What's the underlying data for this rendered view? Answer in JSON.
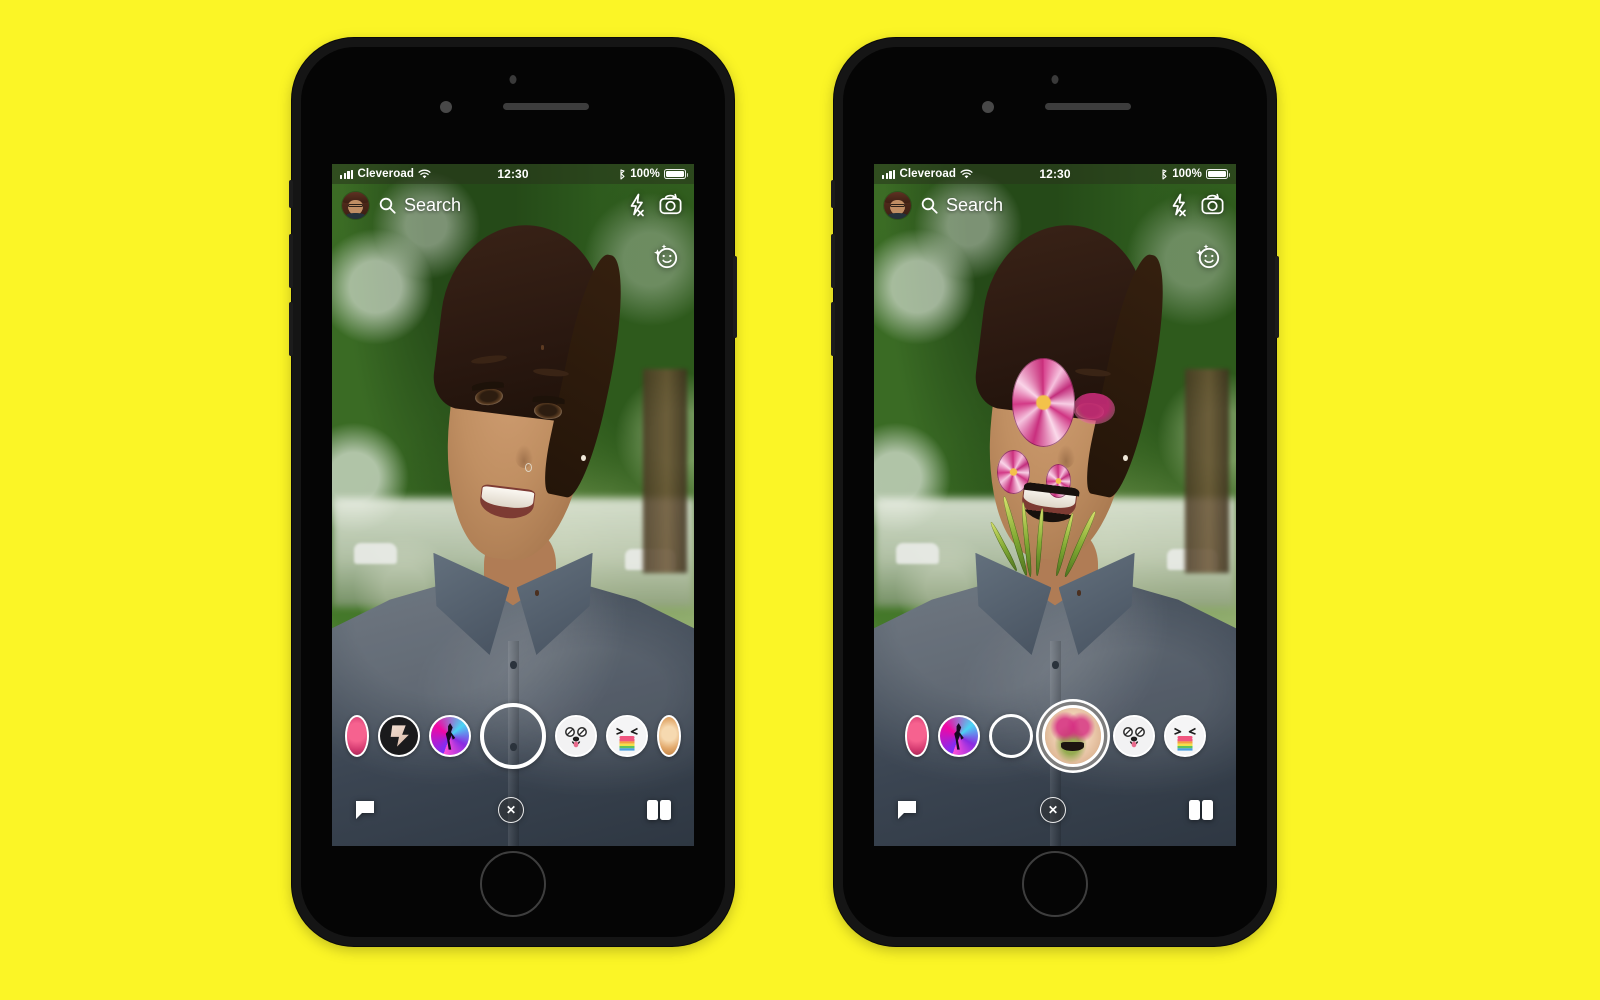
{
  "background": {
    "color": "#FBF526"
  },
  "status_bar": {
    "carrier": "Cleveroad",
    "time": "12:30",
    "battery_percent": "100%",
    "signal_icon": "cellular-bars-icon",
    "wifi_icon": "wifi-icon",
    "bluetooth_icon": "bluetooth-icon",
    "battery_icon": "battery-full-icon"
  },
  "top_bar": {
    "avatar_name": "bitmoji-avatar",
    "search_placeholder": "Search",
    "search_icon": "search-icon",
    "flash_icon": "flash-off-icon",
    "camera_flip_icon": "camera-flip-icon",
    "lens_toggle_icon": "lens-smiley-icon"
  },
  "bottom_nav": {
    "chat_icon": "chat-bubble-icon",
    "close_icon": "close-x-icon",
    "close_label": "✕",
    "stories_icon": "stories-cards-icon"
  },
  "phones": [
    {
      "id": "phone-left",
      "state_label": "camera-no-lens-applied",
      "carousel": {
        "shutter_name": "shutter-button",
        "shutter_selected": false,
        "lenses": [
          {
            "name": "lens-pink-edge",
            "art": "th-pink",
            "edge": true,
            "selected": false
          },
          {
            "name": "lens-dark-figure",
            "art": "th-dark",
            "edge": false,
            "selected": false
          },
          {
            "name": "lens-disco",
            "art": "th-disco",
            "edge": false,
            "selected": false
          }
        ],
        "lenses_right": [
          {
            "name": "lens-panda",
            "art": "th-panda",
            "edge": false,
            "selected": false,
            "glyph": "panda"
          },
          {
            "name": "lens-rainbow",
            "art": "th-rainbow",
            "edge": false,
            "selected": false,
            "glyph": "rainbow"
          },
          {
            "name": "lens-fox-edge",
            "art": "th-fox",
            "edge": true,
            "selected": false
          }
        ]
      }
    },
    {
      "id": "phone-right",
      "state_label": "camera-floral-lens-applied",
      "carousel": {
        "shutter_name": "shutter-button",
        "shutter_selected": true,
        "lenses": [
          {
            "name": "lens-pink-edge",
            "art": "th-pink",
            "edge": true,
            "selected": false
          },
          {
            "name": "lens-disco",
            "art": "th-disco",
            "edge": false,
            "selected": false
          }
        ],
        "selected_lens": {
          "name": "lens-floral-face-paint",
          "art": "th-face"
        },
        "lenses_right": [
          {
            "name": "lens-panda",
            "art": "th-panda",
            "edge": false,
            "selected": false,
            "glyph": "panda"
          },
          {
            "name": "lens-rainbow",
            "art": "th-rainbow",
            "edge": false,
            "selected": false,
            "glyph": "rainbow"
          }
        ]
      }
    }
  ],
  "scene": {
    "subject": "smiling-woman-selfie",
    "background": "green-tree-foliage",
    "lens_effect": "pink-flowers-and-green-stems-face-paint"
  }
}
